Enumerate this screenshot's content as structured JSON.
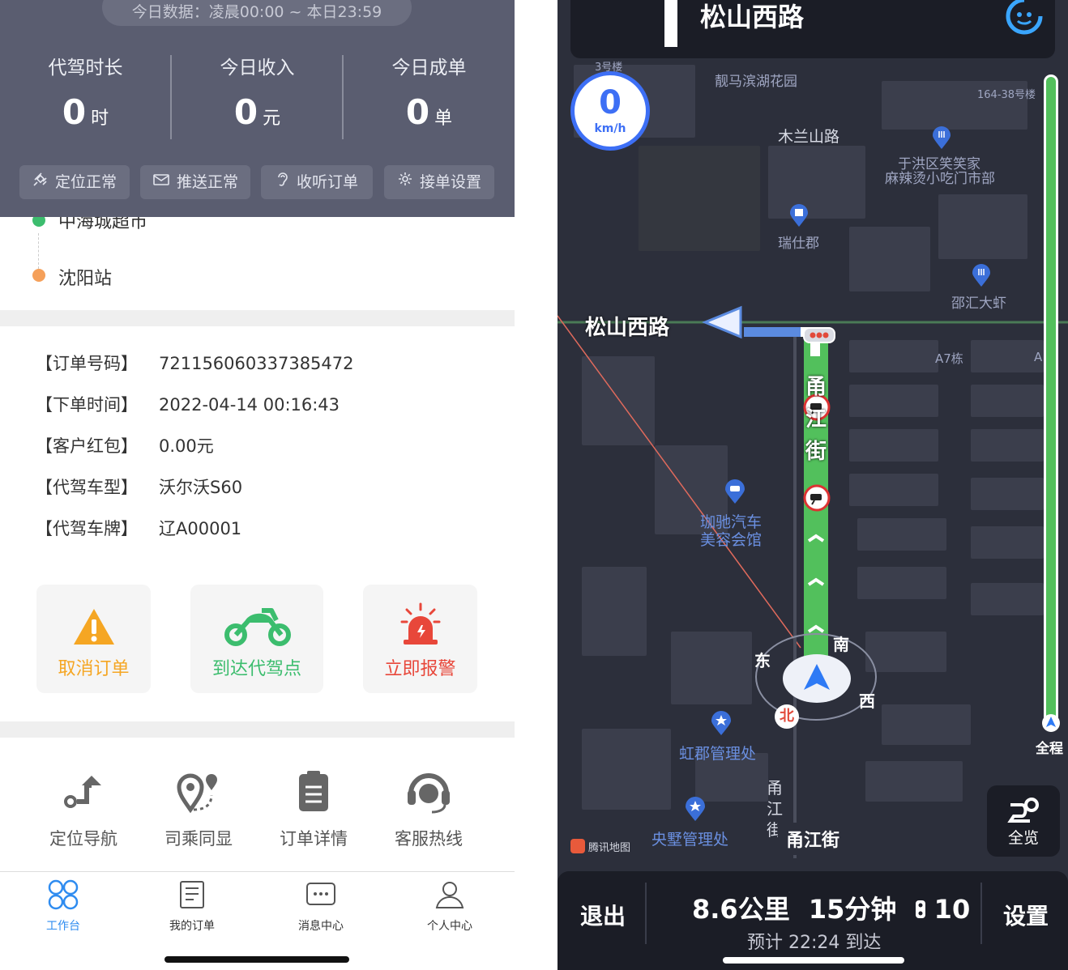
{
  "left": {
    "stats": {
      "range": "今日数据：凌晨00:00 ~ 本日23:59",
      "items": [
        {
          "label": "代驾时长",
          "value": "0",
          "unit": "时"
        },
        {
          "label": "今日收入",
          "value": "0",
          "unit": "元"
        },
        {
          "label": "今日成单",
          "value": "0",
          "unit": "单"
        }
      ],
      "chips": [
        {
          "label": "定位正常",
          "icon": "satellite-icon"
        },
        {
          "label": "推送正常",
          "icon": "mail-icon"
        },
        {
          "label": "收听订单",
          "icon": "ear-icon"
        },
        {
          "label": "接单设置",
          "icon": "gear-icon"
        }
      ]
    },
    "route": {
      "start": "中海城超市",
      "end": "沈阳站"
    },
    "order": [
      {
        "key": "【订单号码】",
        "value": "721156060337385472"
      },
      {
        "key": "【下单时间】",
        "value": "2022-04-14 00:16:43"
      },
      {
        "key": "【客户红包】",
        "value": "0.00元"
      },
      {
        "key": "【代驾车型】",
        "value": "沃尔沃S60"
      },
      {
        "key": "【代驾车牌】",
        "value": "辽A00001"
      }
    ],
    "actions": [
      {
        "label": "取消订单",
        "color": "#f5a623",
        "icon": "warning-icon"
      },
      {
        "label": "到达代驾点",
        "color": "#3cbd6e",
        "icon": "motorcycle-icon"
      },
      {
        "label": "立即报警",
        "color": "#e8473a",
        "icon": "alarm-icon"
      }
    ],
    "tools": [
      {
        "label": "定位导航",
        "icon": "navigation-turn-icon"
      },
      {
        "label": "司乘同显",
        "icon": "route-pin-icon"
      },
      {
        "label": "订单详情",
        "icon": "clipboard-icon"
      },
      {
        "label": "客服热线",
        "icon": "headset-icon"
      }
    ],
    "tabs": [
      {
        "label": "工作台",
        "icon": "grid-icon",
        "active": true
      },
      {
        "label": "我的订单",
        "icon": "document-icon",
        "active": false
      },
      {
        "label": "消息中心",
        "icon": "message-icon",
        "active": false
      },
      {
        "label": "个人中心",
        "icon": "person-icon",
        "active": false
      }
    ]
  },
  "right": {
    "top_street": "松山西路",
    "speed": {
      "value": "0",
      "unit": "km/h"
    },
    "pois": {
      "p1": "3号楼",
      "p2": "靓马滨湖花园",
      "p3": "164-38号楼",
      "p4": "木兰山路",
      "p5": "于洪区笑笑家",
      "p6": "麻辣烫小吃门市部",
      "p7": "瑞仕郡",
      "p8": "邵汇大虾",
      "p9": "A7栋",
      "p10": "A",
      "p11": "珈驰汽车",
      "p12": "美容会馆",
      "p13": "虹郡管理处",
      "p14": "央墅管理处",
      "p15": "腾讯地图"
    },
    "streets": {
      "main": "松山西路",
      "vertical": "甬江街",
      "bottom_vertical": "甬江街",
      "bottom_label": "甬江街"
    },
    "compass": {
      "east": "东",
      "south": "南",
      "west": "西",
      "north": "北"
    },
    "progress_label": "全程",
    "overview_label": "全览",
    "bottom": {
      "exit": "退出",
      "distance": "8.6公里",
      "duration": "15分钟",
      "lights": "10",
      "eta": "预计 22:24 到达",
      "settings": "设置"
    }
  }
}
